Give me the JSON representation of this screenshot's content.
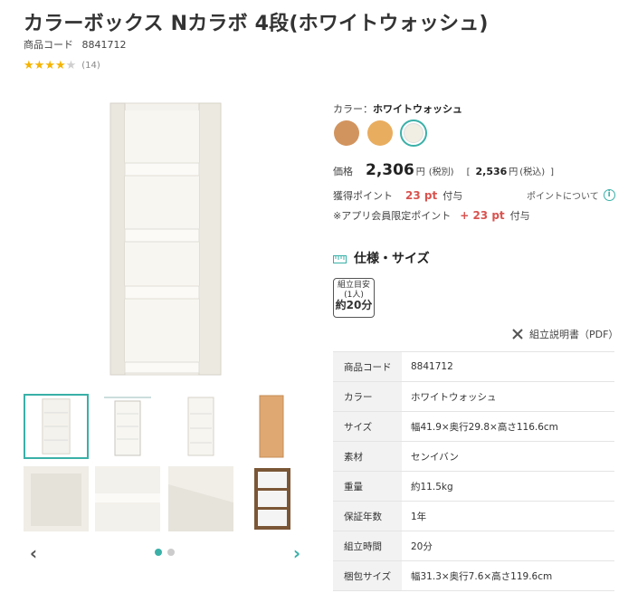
{
  "product": {
    "title": "カラーボックス Nカラボ 4段(ホワイトウォッシュ)",
    "code_label": "商品コード",
    "code": "8841712",
    "rating": 4,
    "review_count": "(14)"
  },
  "gallery": {
    "prev_icon": "chevron-left-icon",
    "next_icon": "chevron-right-icon",
    "pages": 2,
    "current_page": 1
  },
  "color": {
    "label": "カラー：",
    "selected": "ホワイトウォッシュ",
    "swatches": [
      {
        "name": "brown",
        "hex": "#d2945e"
      },
      {
        "name": "natural",
        "hex": "#e9ad5f"
      },
      {
        "name": "white-wash",
        "hex": "#f1eee4"
      }
    ]
  },
  "price": {
    "label": "価格",
    "value": "2,306",
    "unit": "円",
    "tax_note": "(税別)",
    "open": "[",
    "incl_value": "2,536",
    "incl_unit": "円",
    "incl_note": "(税込)",
    "close": "]"
  },
  "points": {
    "label": "獲得ポイント",
    "value": "23 pt",
    "suffix": "付与",
    "about": "ポイントについて",
    "app_label": "※アプリ会員限定ポイント",
    "app_value": "+ 23 pt",
    "app_suffix": "付与"
  },
  "spec": {
    "heading": "仕様・サイズ",
    "badge_line1": "組立目安",
    "badge_line2": "(1人)",
    "badge_line3": "約20分",
    "manual": "組立説明書（PDF）",
    "rows": [
      {
        "key": "商品コード",
        "value": "8841712"
      },
      {
        "key": "カラー",
        "value": "ホワイトウォッシュ"
      },
      {
        "key": "サイズ",
        "value": "幅41.9×奥行29.8×高さ116.6cm"
      },
      {
        "key": "素材",
        "value": "センイバン"
      },
      {
        "key": "重量",
        "value": "約11.5kg"
      },
      {
        "key": "保証年数",
        "value": "1年"
      },
      {
        "key": "組立時間",
        "value": "20分"
      },
      {
        "key": "梱包サイズ",
        "value": "幅31.3×奥行7.6×高さ119.6cm"
      }
    ]
  },
  "colors": {
    "accent": "#3ab0a8",
    "point_red": "#d9534f",
    "star": "#f5b400"
  }
}
